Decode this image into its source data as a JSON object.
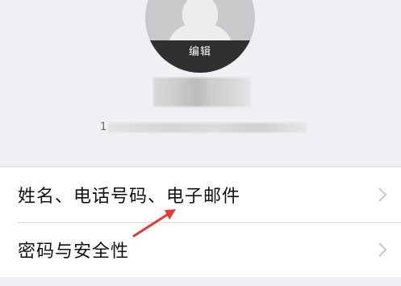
{
  "profile": {
    "edit_label": "编辑",
    "account_prefix": "1"
  },
  "settings": {
    "items": [
      {
        "label": "姓名、电话号码、电子邮件"
      },
      {
        "label": "密码与安全性"
      }
    ]
  },
  "colors": {
    "background": "#efeff4",
    "row_background": "#ffffff",
    "text": "#111111",
    "chevron": "#c7c7cc",
    "annotation_arrow": "#e53935"
  },
  "icons": {
    "chevron": "chevron-right-icon",
    "annotation": "red-arrow-icon"
  }
}
